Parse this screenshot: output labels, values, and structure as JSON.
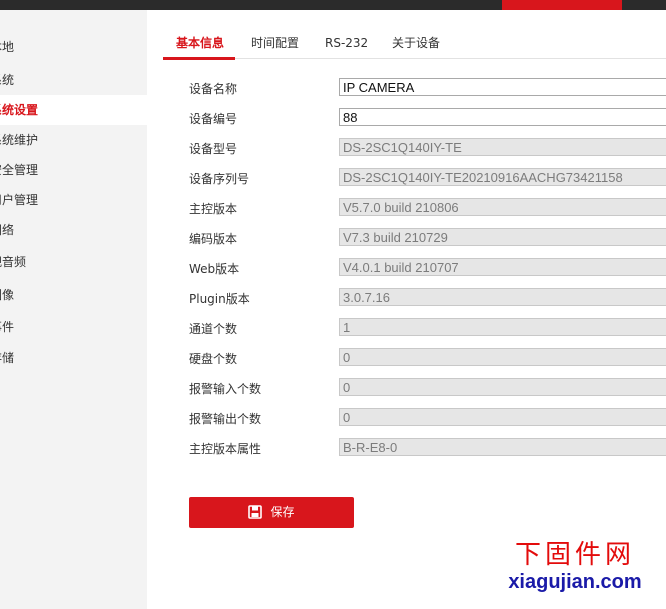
{
  "sidebar": {
    "items": [
      {
        "label": "本地",
        "active": false
      },
      {
        "label": "系统",
        "active": false
      },
      {
        "label": "系统设置",
        "active": true
      },
      {
        "label": "系统维护",
        "active": false
      },
      {
        "label": "安全管理",
        "active": false
      },
      {
        "label": "用户管理",
        "active": false
      },
      {
        "label": "网络",
        "active": false
      },
      {
        "label": "视音频",
        "active": false
      },
      {
        "label": "图像",
        "active": false
      },
      {
        "label": "事件",
        "active": false
      },
      {
        "label": "存储",
        "active": false
      }
    ]
  },
  "tabs": [
    {
      "label": "基本信息",
      "active": true
    },
    {
      "label": "时间配置",
      "active": false
    },
    {
      "label": "RS-232",
      "active": false
    },
    {
      "label": "关于设备",
      "active": false
    }
  ],
  "form": {
    "rows": [
      {
        "label": "设备名称",
        "value": "IP CAMERA",
        "editable": true
      },
      {
        "label": "设备编号",
        "value": "88",
        "editable": true
      },
      {
        "label": "设备型号",
        "value": "DS-2SC1Q140IY-TE",
        "editable": false
      },
      {
        "label": "设备序列号",
        "value": "DS-2SC1Q140IY-TE20210916AACHG73421158",
        "editable": false
      },
      {
        "label": "主控版本",
        "value": "V5.7.0 build 210806",
        "editable": false
      },
      {
        "label": "编码版本",
        "value": "V7.3 build 210729",
        "editable": false
      },
      {
        "label": "Web版本",
        "value": "V4.0.1 build 210707",
        "editable": false
      },
      {
        "label": "Plugin版本",
        "value": "3.0.7.16",
        "editable": false
      },
      {
        "label": "通道个数",
        "value": "1",
        "editable": false
      },
      {
        "label": "硬盘个数",
        "value": "0",
        "editable": false
      },
      {
        "label": "报警输入个数",
        "value": "0",
        "editable": false
      },
      {
        "label": "报警输出个数",
        "value": "0",
        "editable": false
      },
      {
        "label": "主控版本属性",
        "value": "B-R-E8-0",
        "editable": false
      }
    ]
  },
  "actions": {
    "save_label": "保存",
    "save_icon": "save-icon"
  },
  "watermark": {
    "chinese": "下固件网",
    "site": "xiagujian.com"
  },
  "colors": {
    "accent": "#d8161c",
    "topbar": "#2b2b2b",
    "sidebar_bg": "#f3f3f3",
    "readonly_bg": "#e6e6e6"
  }
}
